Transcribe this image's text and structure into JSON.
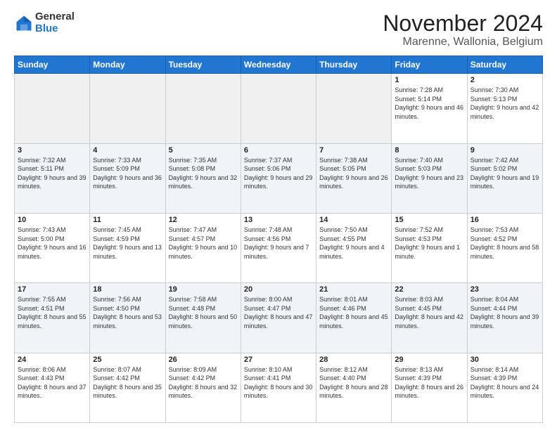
{
  "logo": {
    "general": "General",
    "blue": "Blue"
  },
  "header": {
    "title": "November 2024",
    "subtitle": "Marenne, Wallonia, Belgium"
  },
  "weekdays": [
    "Sunday",
    "Monday",
    "Tuesday",
    "Wednesday",
    "Thursday",
    "Friday",
    "Saturday"
  ],
  "weeks": [
    [
      {
        "day": "",
        "info": ""
      },
      {
        "day": "",
        "info": ""
      },
      {
        "day": "",
        "info": ""
      },
      {
        "day": "",
        "info": ""
      },
      {
        "day": "",
        "info": ""
      },
      {
        "day": "1",
        "info": "Sunrise: 7:28 AM\nSunset: 5:14 PM\nDaylight: 9 hours and 46 minutes."
      },
      {
        "day": "2",
        "info": "Sunrise: 7:30 AM\nSunset: 5:13 PM\nDaylight: 9 hours and 42 minutes."
      }
    ],
    [
      {
        "day": "3",
        "info": "Sunrise: 7:32 AM\nSunset: 5:11 PM\nDaylight: 9 hours and 39 minutes."
      },
      {
        "day": "4",
        "info": "Sunrise: 7:33 AM\nSunset: 5:09 PM\nDaylight: 9 hours and 36 minutes."
      },
      {
        "day": "5",
        "info": "Sunrise: 7:35 AM\nSunset: 5:08 PM\nDaylight: 9 hours and 32 minutes."
      },
      {
        "day": "6",
        "info": "Sunrise: 7:37 AM\nSunset: 5:06 PM\nDaylight: 9 hours and 29 minutes."
      },
      {
        "day": "7",
        "info": "Sunrise: 7:38 AM\nSunset: 5:05 PM\nDaylight: 9 hours and 26 minutes."
      },
      {
        "day": "8",
        "info": "Sunrise: 7:40 AM\nSunset: 5:03 PM\nDaylight: 9 hours and 23 minutes."
      },
      {
        "day": "9",
        "info": "Sunrise: 7:42 AM\nSunset: 5:02 PM\nDaylight: 9 hours and 19 minutes."
      }
    ],
    [
      {
        "day": "10",
        "info": "Sunrise: 7:43 AM\nSunset: 5:00 PM\nDaylight: 9 hours and 16 minutes."
      },
      {
        "day": "11",
        "info": "Sunrise: 7:45 AM\nSunset: 4:59 PM\nDaylight: 9 hours and 13 minutes."
      },
      {
        "day": "12",
        "info": "Sunrise: 7:47 AM\nSunset: 4:57 PM\nDaylight: 9 hours and 10 minutes."
      },
      {
        "day": "13",
        "info": "Sunrise: 7:48 AM\nSunset: 4:56 PM\nDaylight: 9 hours and 7 minutes."
      },
      {
        "day": "14",
        "info": "Sunrise: 7:50 AM\nSunset: 4:55 PM\nDaylight: 9 hours and 4 minutes."
      },
      {
        "day": "15",
        "info": "Sunrise: 7:52 AM\nSunset: 4:53 PM\nDaylight: 9 hours and 1 minute."
      },
      {
        "day": "16",
        "info": "Sunrise: 7:53 AM\nSunset: 4:52 PM\nDaylight: 8 hours and 58 minutes."
      }
    ],
    [
      {
        "day": "17",
        "info": "Sunrise: 7:55 AM\nSunset: 4:51 PM\nDaylight: 8 hours and 55 minutes."
      },
      {
        "day": "18",
        "info": "Sunrise: 7:56 AM\nSunset: 4:50 PM\nDaylight: 8 hours and 53 minutes."
      },
      {
        "day": "19",
        "info": "Sunrise: 7:58 AM\nSunset: 4:48 PM\nDaylight: 8 hours and 50 minutes."
      },
      {
        "day": "20",
        "info": "Sunrise: 8:00 AM\nSunset: 4:47 PM\nDaylight: 8 hours and 47 minutes."
      },
      {
        "day": "21",
        "info": "Sunrise: 8:01 AM\nSunset: 4:46 PM\nDaylight: 8 hours and 45 minutes."
      },
      {
        "day": "22",
        "info": "Sunrise: 8:03 AM\nSunset: 4:45 PM\nDaylight: 8 hours and 42 minutes."
      },
      {
        "day": "23",
        "info": "Sunrise: 8:04 AM\nSunset: 4:44 PM\nDaylight: 8 hours and 39 minutes."
      }
    ],
    [
      {
        "day": "24",
        "info": "Sunrise: 8:06 AM\nSunset: 4:43 PM\nDaylight: 8 hours and 37 minutes."
      },
      {
        "day": "25",
        "info": "Sunrise: 8:07 AM\nSunset: 4:42 PM\nDaylight: 8 hours and 35 minutes."
      },
      {
        "day": "26",
        "info": "Sunrise: 8:09 AM\nSunset: 4:42 PM\nDaylight: 8 hours and 32 minutes."
      },
      {
        "day": "27",
        "info": "Sunrise: 8:10 AM\nSunset: 4:41 PM\nDaylight: 8 hours and 30 minutes."
      },
      {
        "day": "28",
        "info": "Sunrise: 8:12 AM\nSunset: 4:40 PM\nDaylight: 8 hours and 28 minutes."
      },
      {
        "day": "29",
        "info": "Sunrise: 8:13 AM\nSunset: 4:39 PM\nDaylight: 8 hours and 26 minutes."
      },
      {
        "day": "30",
        "info": "Sunrise: 8:14 AM\nSunset: 4:39 PM\nDaylight: 8 hours and 24 minutes."
      }
    ]
  ]
}
